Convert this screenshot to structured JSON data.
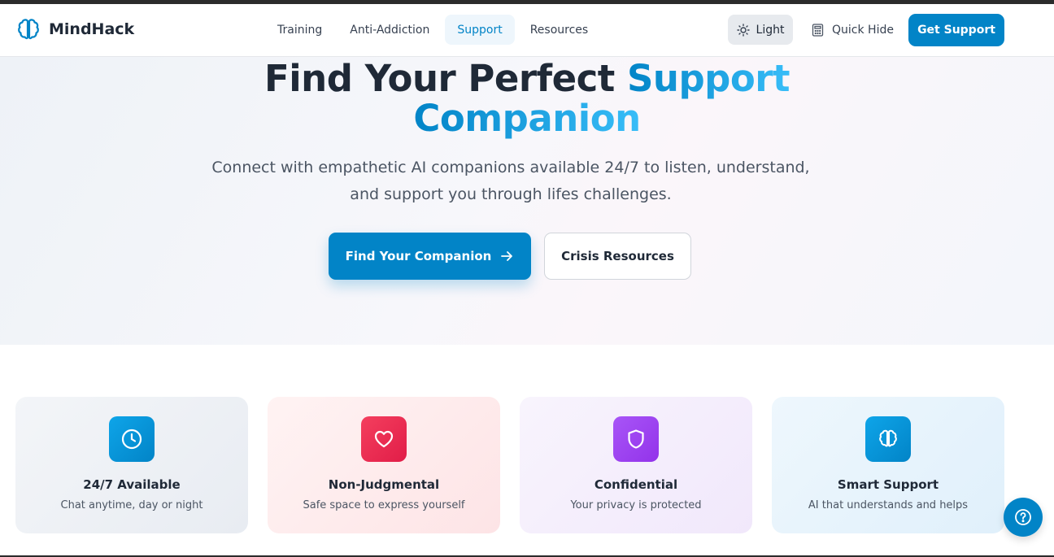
{
  "brand": {
    "name": "MindHack",
    "icon": "brain-icon"
  },
  "nav": {
    "links": [
      {
        "label": "Training",
        "active": false
      },
      {
        "label": "Anti-Addiction",
        "active": false
      },
      {
        "label": "Support",
        "active": true
      },
      {
        "label": "Resources",
        "active": false
      }
    ],
    "theme_label": "Light",
    "theme_icon": "sun-icon",
    "quick_hide_label": "Quick Hide",
    "quick_hide_icon": "calculator-icon",
    "cta_label": "Get Support"
  },
  "hero": {
    "title_part1": "Find Your Perfect ",
    "title_accent_1": "Support",
    "title_accent_2": "Companion",
    "subtitle": "Connect with empathetic AI companions available 24/7 to listen, understand, and support you through lifes challenges.",
    "primary_cta": "Find Your Companion",
    "primary_cta_icon": "arrow-right-icon",
    "secondary_cta": "Crisis Resources"
  },
  "features": [
    {
      "title": "24/7 Available",
      "desc": "Chat anytime, day or night",
      "icon": "clock-icon"
    },
    {
      "title": "Non-Judgmental",
      "desc": "Safe space to express yourself",
      "icon": "heart-icon"
    },
    {
      "title": "Confidential",
      "desc": "Your privacy is protected",
      "icon": "shield-icon"
    },
    {
      "title": "Smart Support",
      "desc": "AI that understands and helps",
      "icon": "brain-icon"
    }
  ],
  "help_button": {
    "icon": "help-icon"
  },
  "colors": {
    "primary": "#0284c7",
    "accent": "#0ea5e9",
    "heart": "#e11d48",
    "shield": "#9333ea",
    "text_dark": "#1f2937"
  }
}
